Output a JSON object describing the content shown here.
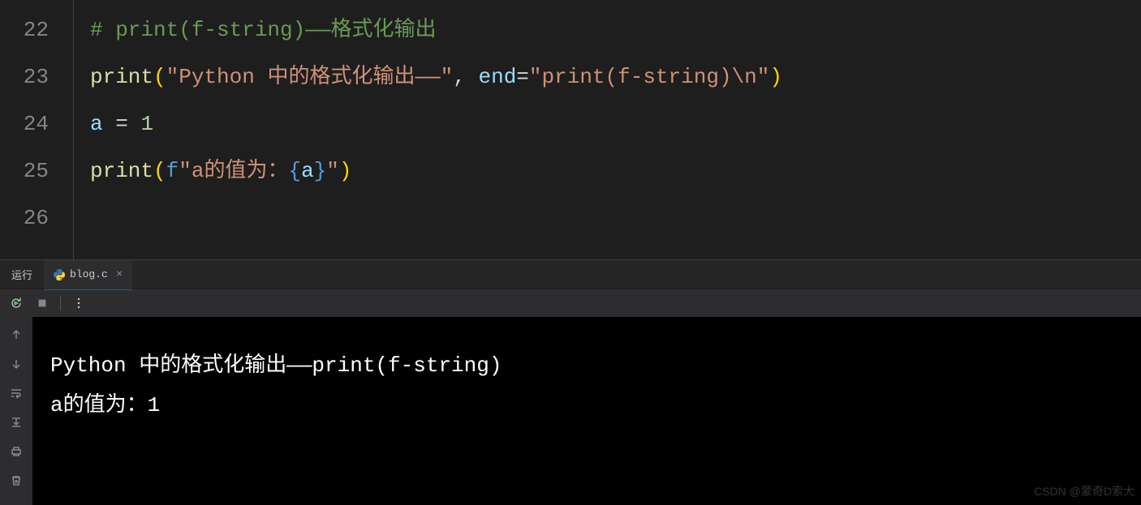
{
  "editor": {
    "lines": {
      "n22": "22",
      "n23": "23",
      "n24": "24",
      "n25": "25",
      "n26": "26"
    },
    "code": {
      "line22": {
        "comment": "# print(f-string)——格式化输出"
      },
      "line23": {
        "fn": "print",
        "lparen": "(",
        "str1": "\"Python 中的格式化输出——\"",
        "comma": ",",
        "space": " ",
        "kwarg": "end",
        "eq": "=",
        "str2": "\"print(f-string)\\n\"",
        "rparen": ")"
      },
      "line24": {
        "var": "a",
        "sp1": " ",
        "op": "=",
        "sp2": " ",
        "num": "1"
      },
      "line25": {
        "fn": "print",
        "lparen": "(",
        "fprefix": "f",
        "str_open": "\"a的值为：",
        "lbrace": "{",
        "fvar": "a",
        "rbrace": "}",
        "str_close": "\"",
        "rparen": ")"
      }
    }
  },
  "panel": {
    "run_label": "运行",
    "tab": {
      "name": "blog.c",
      "close": "×"
    },
    "toolbar": {
      "restart_title": "重启",
      "stop_title": "停止",
      "more_title": "更多"
    }
  },
  "terminal": {
    "out1": "Python 中的格式化输出——print(f-string)",
    "out2": "a的值为：1"
  },
  "watermark": "CSDN @蒙奇D索大"
}
